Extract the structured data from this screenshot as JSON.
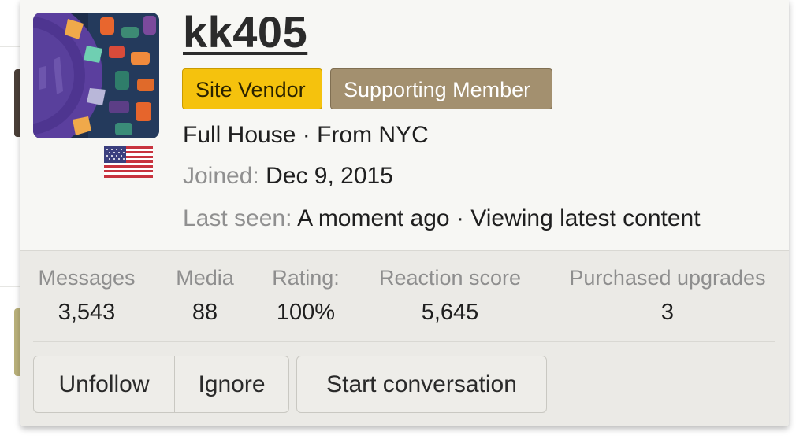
{
  "user": {
    "username": "kk405",
    "badges": {
      "vendor": "Site Vendor",
      "supporting": "Supporting Member"
    },
    "title_prefix": "Full House",
    "separator": "·",
    "location": "From NYC",
    "joined_label": "Joined:",
    "joined_value": "Dec 9, 2015",
    "last_seen_label": "Last seen:",
    "last_seen_value": "A moment ago",
    "activity": "Viewing latest content",
    "flag": "us-flag-icon"
  },
  "stats": {
    "messages": {
      "label": "Messages",
      "value": "3,543"
    },
    "media": {
      "label": "Media",
      "value": "88"
    },
    "rating": {
      "label": "Rating:",
      "value": "100%"
    },
    "reaction_score": {
      "label": "Reaction score",
      "value": "5,645"
    },
    "purchased_upgrades": {
      "label": "Purchased upgrades",
      "value": "3"
    }
  },
  "actions": {
    "unfollow": "Unfollow",
    "ignore": "Ignore",
    "start_conversation": "Start conversation"
  },
  "colors": {
    "vendor_badge": "#f5c20d",
    "supporting_badge": "#a3906f",
    "card_background": "#f7f7f4",
    "stats_background": "#ebeae6",
    "muted_text": "#909090"
  }
}
